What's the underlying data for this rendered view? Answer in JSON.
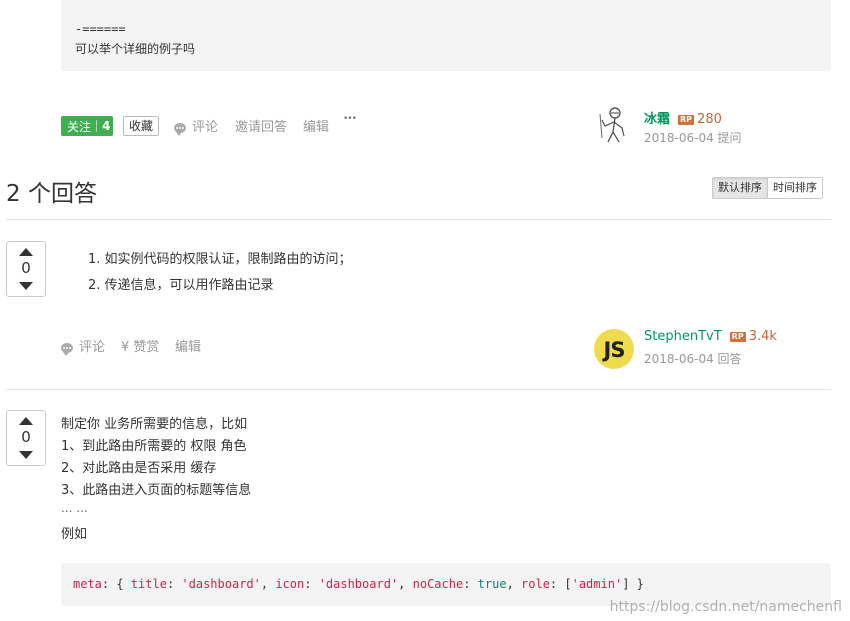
{
  "question": {
    "code_block": {
      "line1": "-======",
      "line2": "可以举个详细的例子吗"
    },
    "actions": {
      "follow_label": "关注",
      "follow_count": "4",
      "collect_label": "收藏",
      "comment_label": "评论",
      "invite_label": "邀请回答",
      "edit_label": "编辑",
      "more_label": "•••"
    },
    "author": {
      "name": "冰霜",
      "rp_badge": "RP",
      "rp": "280",
      "meta": "2018-06-04 提问"
    }
  },
  "answers_header": {
    "title": "2 个回答",
    "sort_default": "默认排序",
    "sort_time": "时间排序"
  },
  "answers": [
    {
      "votes": "0",
      "items": [
        "如实例代码的权限认证，限制路由的访问；",
        "传递信息，可以用作路由记录"
      ],
      "item_numbers": [
        "1.",
        "2."
      ],
      "actions": {
        "comment_label": "评论",
        "reward_label": "¥ 赞赏",
        "edit_label": "编辑"
      },
      "author": {
        "name": "StephenTvT",
        "avatar_text": "JS",
        "rp_badge": "RP",
        "rp": "3.4k",
        "meta": "2018-06-04 回答"
      }
    },
    {
      "votes": "0",
      "lines": [
        "制定你 业务所需要的信息，比如",
        "1、到此路由所需要的 权限 角色",
        "2、对此路由是否采用 缓存",
        "3、此路由进入页面的标题等信息",
        "... ...",
        "例如"
      ],
      "code": {
        "meta": "meta",
        "open": ": { ",
        "title_key": "title",
        "title_val": "'dashboard'",
        "icon_key": "icon",
        "icon_val": "'dashboard'",
        "nocache_key": "noCache",
        "nocache_val": "true",
        "role_key": "role",
        "role_val": "'admin'",
        "close": "] }"
      }
    }
  ],
  "watermark": "https://blog.csdn.net/namechenfl",
  "colors": {
    "accent_green": "#009a61",
    "follow_green": "#3faf50",
    "rp_orange": "#d0703a",
    "code_red": "#c7254e",
    "code_teal": "#0e7f7a"
  }
}
